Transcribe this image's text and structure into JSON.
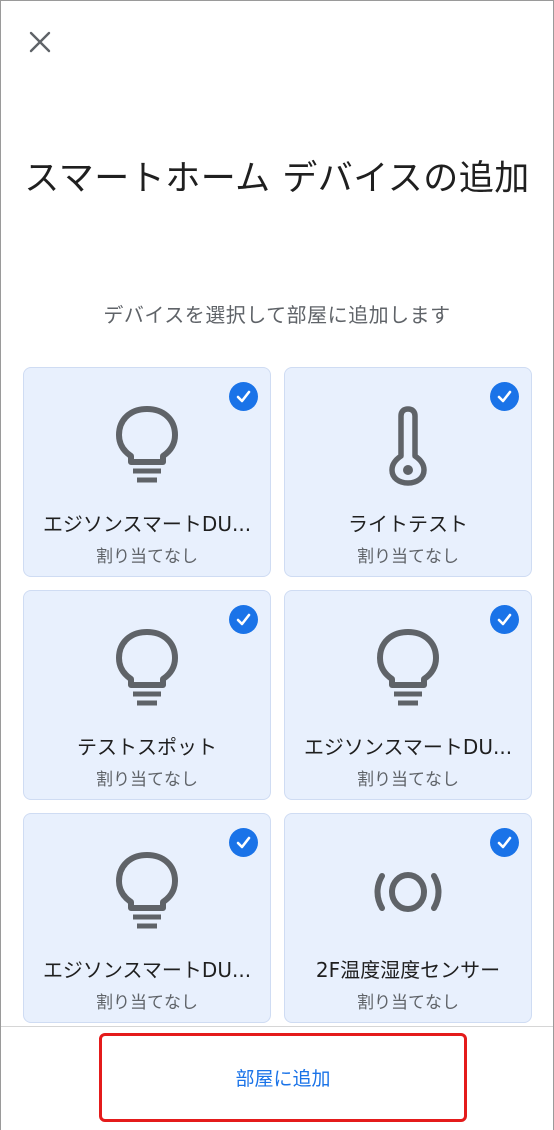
{
  "header": {
    "close_icon": "close-icon",
    "title": "スマートホーム デバイスの追加",
    "subtitle": "デバイスを選択して部屋に追加します"
  },
  "colors": {
    "accent": "#1a73e8",
    "card_bg": "#e8f0fd",
    "highlight_border": "#e41b1b"
  },
  "devices": [
    {
      "name": "エジソンスマートDU...",
      "status": "割り当てなし",
      "icon": "lightbulb-icon",
      "selected": true
    },
    {
      "name": "ライトテスト",
      "status": "割り当てなし",
      "icon": "thermometer-icon",
      "selected": true
    },
    {
      "name": "テストスポット",
      "status": "割り当てなし",
      "icon": "lightbulb-icon",
      "selected": true
    },
    {
      "name": "エジソンスマートDU...",
      "status": "割り当てなし",
      "icon": "lightbulb-icon",
      "selected": true
    },
    {
      "name": "エジソンスマートDU...",
      "status": "割り当てなし",
      "icon": "lightbulb-icon",
      "selected": true
    },
    {
      "name": "2F温度湿度センサー",
      "status": "割り当てなし",
      "icon": "sensor-icon",
      "selected": true
    }
  ],
  "footer": {
    "add_button_label": "部屋に追加"
  }
}
